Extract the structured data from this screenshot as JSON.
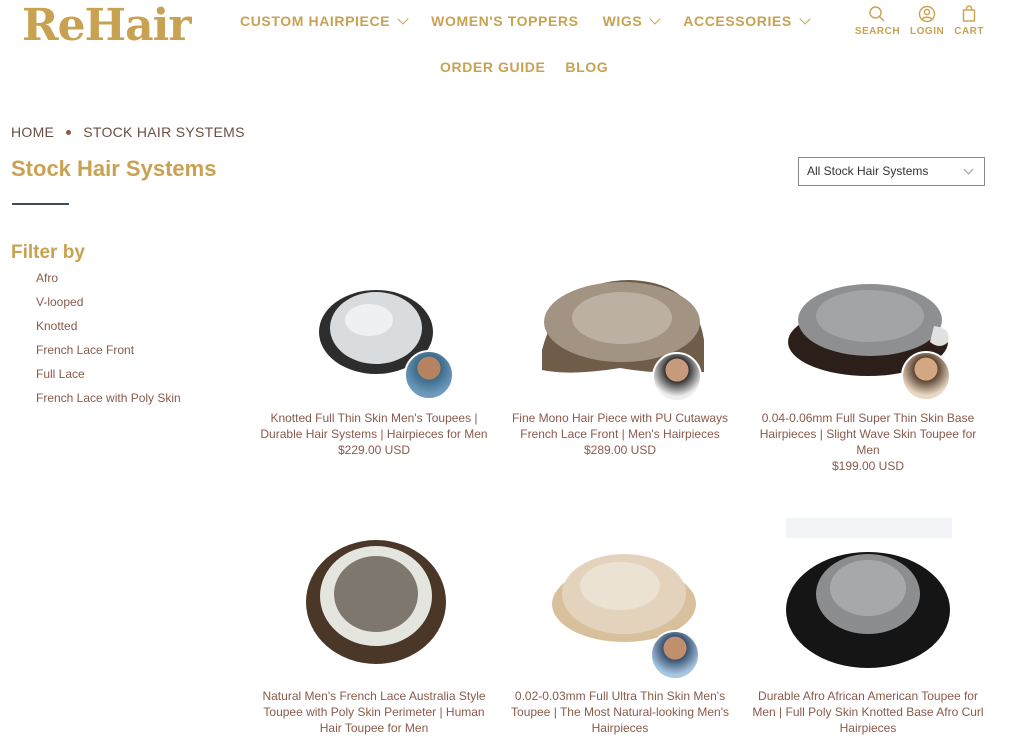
{
  "brand": {
    "logo": "ReHair"
  },
  "nav": {
    "row1": [
      {
        "label": "CUSTOM HAIRPIECE",
        "chevron": true
      },
      {
        "label": "WOMEN'S TOPPERS",
        "chevron": false
      },
      {
        "label": "WIGS",
        "chevron": true
      },
      {
        "label": "ACCESSORIES",
        "chevron": true
      }
    ],
    "row2": [
      {
        "label": "ORDER GUIDE"
      },
      {
        "label": "BLOG"
      }
    ]
  },
  "utils": {
    "search": "SEARCH",
    "login": "LOGIN",
    "cart": "CART"
  },
  "breadcrumb": {
    "home": "HOME",
    "current": "STOCK HAIR SYSTEMS"
  },
  "page": {
    "title": "Stock Hair Systems"
  },
  "sort": {
    "selected": "All Stock Hair Systems"
  },
  "filter": {
    "title": "Filter by",
    "items": [
      "Afro",
      "V-looped",
      "Knotted",
      "French Lace Front",
      "Full Lace",
      "French Lace with Poly Skin"
    ]
  },
  "products": [
    {
      "name": "Knotted Full Thin Skin Men's Toupees | Durable Hair Systems | Hairpieces for Men",
      "price": "$229.00 USD"
    },
    {
      "name": "Fine Mono Hair Piece with PU Cutaways French Lace Front | Men's Hairpieces",
      "price": "$289.00 USD"
    },
    {
      "name": "0.04-0.06mm Full Super Thin Skin Base Hairpieces | Slight Wave Skin Toupee for Men",
      "price": "$199.00 USD"
    },
    {
      "name": "Natural Men's French Lace Australia Style Toupee with Poly Skin Perimeter | Human Hair Toupee for Men",
      "price": ""
    },
    {
      "name": "0.02-0.03mm Full Ultra Thin Skin Men's Toupee | The Most Natural-looking Men's Hairpieces",
      "price": ""
    },
    {
      "name": "Durable Afro African American Toupee for Men | Full Poly Skin Knotted Base Afro Curl Hairpieces",
      "price": ""
    }
  ],
  "colors": {
    "accent": "#c9a251",
    "text": "#8a5a4a"
  }
}
